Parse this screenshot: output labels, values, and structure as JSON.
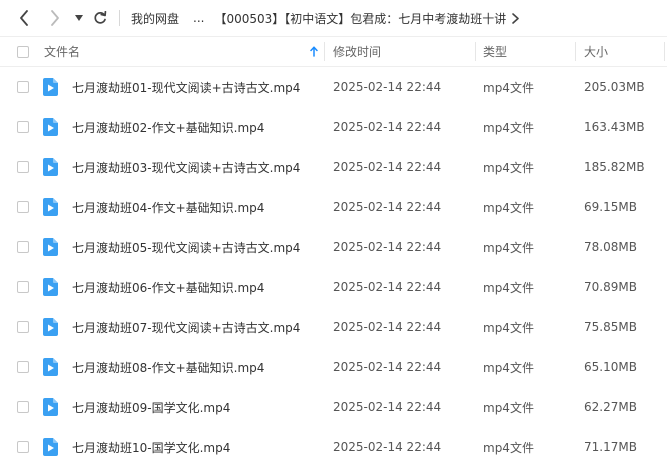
{
  "nav": {
    "breadcrumbs": [
      "我的网盘",
      "...",
      "【000503】【初中语文】包君成：七月中考渡劫班十讲"
    ]
  },
  "columns": {
    "name": "文件名",
    "modified": "修改时间",
    "type": "类型",
    "size": "大小"
  },
  "files": [
    {
      "name": "七月渡劫班01-现代文阅读+古诗古文.mp4",
      "modified": "2025-02-14 22:44",
      "type": "mp4文件",
      "size": "205.03MB"
    },
    {
      "name": "七月渡劫班02-作文+基础知识.mp4",
      "modified": "2025-02-14 22:44",
      "type": "mp4文件",
      "size": "163.43MB"
    },
    {
      "name": "七月渡劫班03-现代文阅读+古诗古文.mp4",
      "modified": "2025-02-14 22:44",
      "type": "mp4文件",
      "size": "185.82MB"
    },
    {
      "name": "七月渡劫班04-作文+基础知识.mp4",
      "modified": "2025-02-14 22:44",
      "type": "mp4文件",
      "size": "69.15MB"
    },
    {
      "name": "七月渡劫班05-现代文阅读+古诗古文.mp4",
      "modified": "2025-02-14 22:44",
      "type": "mp4文件",
      "size": "78.08MB"
    },
    {
      "name": "七月渡劫班06-作文+基础知识.mp4",
      "modified": "2025-02-14 22:44",
      "type": "mp4文件",
      "size": "70.89MB"
    },
    {
      "name": "七月渡劫班07-现代文阅读+古诗古文.mp4",
      "modified": "2025-02-14 22:44",
      "type": "mp4文件",
      "size": "75.85MB"
    },
    {
      "name": "七月渡劫班08-作文+基础知识.mp4",
      "modified": "2025-02-14 22:44",
      "type": "mp4文件",
      "size": "65.10MB"
    },
    {
      "name": "七月渡劫班09-国学文化.mp4",
      "modified": "2025-02-14 22:44",
      "type": "mp4文件",
      "size": "62.27MB"
    },
    {
      "name": "七月渡劫班10-国学文化.mp4",
      "modified": "2025-02-14 22:44",
      "type": "mp4文件",
      "size": "71.17MB"
    }
  ],
  "colors": {
    "accent": "#1a8cff",
    "video_icon": "#3aa0f2"
  },
  "icons": {
    "back": "arrow-left-icon",
    "forward": "arrow-right-icon",
    "history": "caret-down-icon",
    "refresh": "refresh-icon",
    "sort": "sort-up-icon",
    "file": "video-file-icon"
  }
}
